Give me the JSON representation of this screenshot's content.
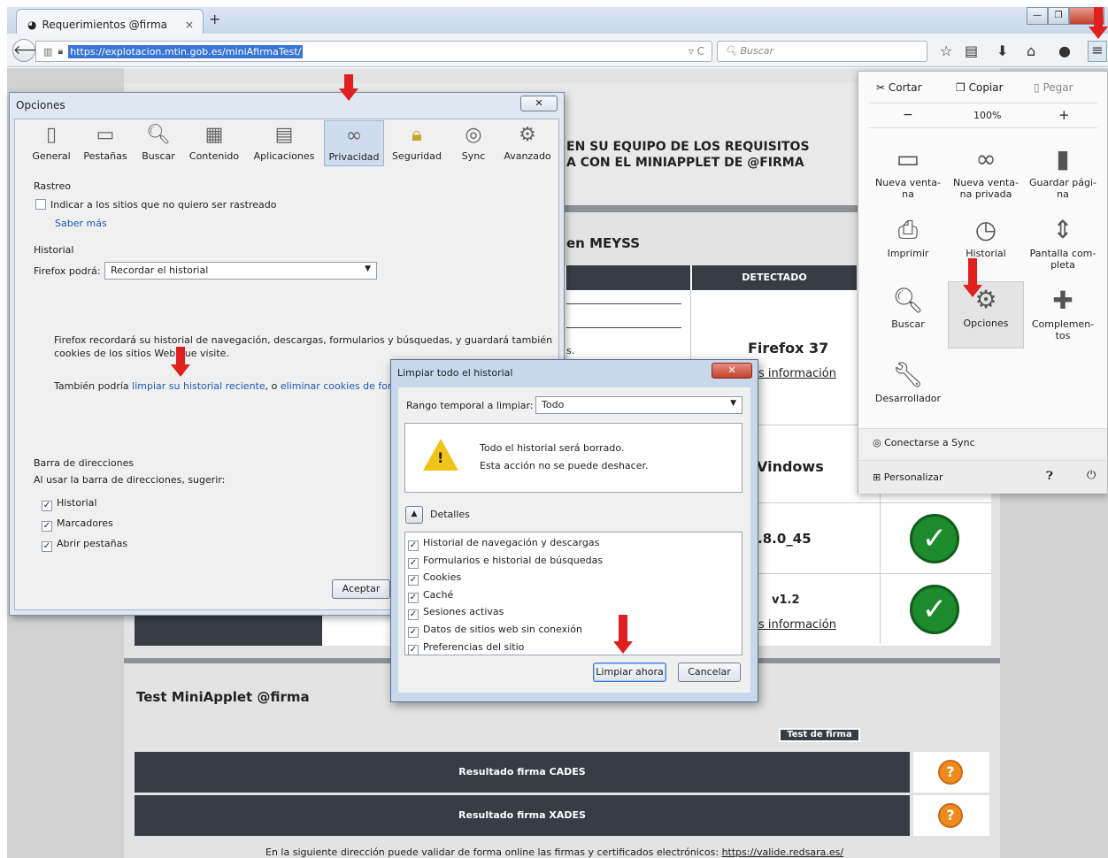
{
  "browser": {
    "tab_title": "Requerimientos @firma",
    "tab_close": "×",
    "new_tab": "+",
    "url": "https://explotacion.mtin.gob.es/miniAfirmaTest/",
    "search_placeholder": "Buscar"
  },
  "page": {
    "heading_line1": "EN SU EQUIPO DE LOS REQUISITOS",
    "heading_line2": "A CON EL MINIAPPLET DE @FIRMA",
    "section_title": "en MEYSS",
    "col_detected": "DETECTADO",
    "row1_value": "Firefox 37",
    "row1_link": "s información",
    "row2_value": "Vindows",
    "row3_value": ".8.0_45",
    "row4_value": "v1.2",
    "row4_link": "s información",
    "stub_s": "s.",
    "test_title": "Test MiniApplet @firma",
    "test_button": "Test de firma",
    "result_cades": "Resultado firma CADES",
    "result_xades": "Resultado firma XADES",
    "footer": "En la siguiente dirección puede validar de forma online las firmas y certificados electrónicos:",
    "footer_link": "https://valide.redsara.es/"
  },
  "options_dialog": {
    "title": "Opciones",
    "tabs": [
      "General",
      "Pestañas",
      "Buscar",
      "Contenido",
      "Aplicaciones",
      "Privacidad",
      "Seguridad",
      "Sync",
      "Avanzado"
    ],
    "tracking_header": "Rastreo",
    "tracking_checkbox": "Indicar a los sitios que no quiero ser rastreado",
    "learn_more": "Saber más",
    "history_header": "Historial",
    "firefox_will": "Firefox podrá:",
    "history_mode": "Recordar el historial",
    "history_desc1": "Firefox recordará su historial de navegación, descargas, formularios y búsquedas, y guardará también",
    "history_desc2": "cookies de los sitios Web que visite.",
    "also_text": "También podría",
    "clear_recent_link": "limpiar su historial reciente",
    "or_text": ", o",
    "remove_cookies_link": "eliminar cookies de forma i",
    "address_header": "Barra de direcciones",
    "address_desc": "Al usar la barra de direcciones, sugerir:",
    "suggest": [
      "Historial",
      "Marcadores",
      "Abrir pestañas"
    ],
    "accept": "Aceptar"
  },
  "clear_dialog": {
    "title": "Limpiar todo el historial",
    "range_label": "Rango temporal a limpiar:",
    "range_value": "Todo",
    "warn1": "Todo el historial será borrado.",
    "warn2": "Esta acción no se puede deshacer.",
    "details": "Detalles",
    "items": [
      "Historial de navegación y descargas",
      "Formularios e historial de búsquedas",
      "Cookies",
      "Caché",
      "Sesiones activas",
      "Datos de sitios web sin conexión",
      "Preferencias del sitio"
    ],
    "clear_now": "Limpiar ahora",
    "cancel": "Cancelar"
  },
  "menu": {
    "cut": "Cortar",
    "copy": "Copiar",
    "paste": "Pegar",
    "zoom_minus": "−",
    "zoom": "100%",
    "zoom_plus": "+",
    "items": [
      "Nueva venta-na",
      "Nueva venta-na privada",
      "Guardar pági-na",
      "Imprimir",
      "Historial",
      "Pantalla com-pleta",
      "Buscar",
      "Opciones",
      "Complemen-tos",
      "Desarrollador"
    ],
    "sync": "Conectarse a Sync",
    "customize": "Personalizar"
  }
}
